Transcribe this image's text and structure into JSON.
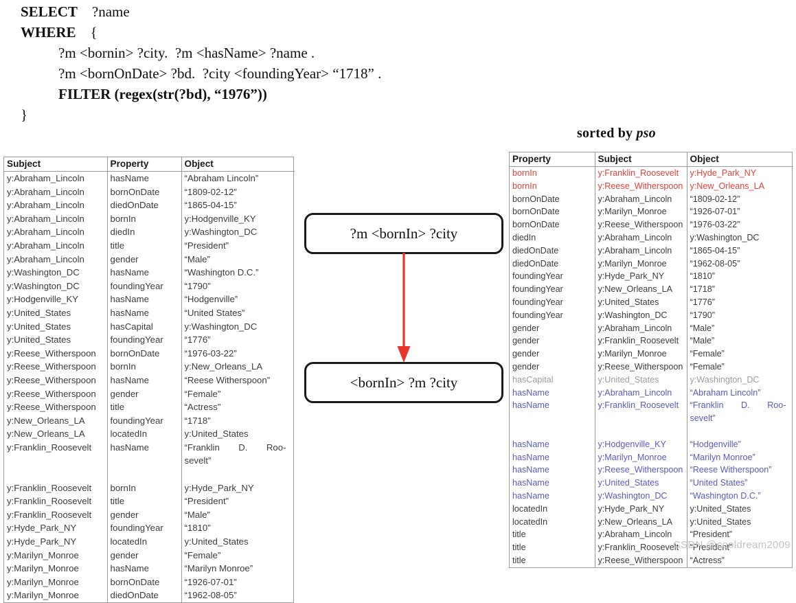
{
  "query": {
    "lines": [
      {
        "id": "l1",
        "indent": 0,
        "segments": [
          {
            "t": "SELECT",
            "bold": true
          },
          {
            "t": "    ?name",
            "bold": false
          }
        ]
      },
      {
        "id": "l2",
        "indent": 0,
        "segments": [
          {
            "t": "WHERE",
            "bold": true
          },
          {
            "t": "    {",
            "bold": false
          }
        ]
      },
      {
        "id": "l3",
        "indent": 55,
        "segments": [
          {
            "t": "?m <bornin> ?city.  ?m <hasName> ?name .",
            "bold": false
          }
        ]
      },
      {
        "id": "l4",
        "indent": 55,
        "segments": [
          {
            "t": "?m <bornOnDate> ?bd.  ?city <foundingYear> “1718” .",
            "bold": false
          }
        ]
      },
      {
        "id": "l5",
        "indent": 55,
        "segments": [
          {
            "t": "FILTER (regex(str(?bd), “1976”))",
            "bold": true
          }
        ]
      },
      {
        "id": "l6",
        "indent": 0,
        "segments": [
          {
            "t": "}",
            "bold": false
          }
        ]
      }
    ],
    "text_lines": [
      "SELECT    ?name",
      "WHERE    {",
      "?m <bornin> ?city.  ?m <hasName> ?name .",
      "?m <bornOnDate> ?bd.  ?city <foundingYear> “1718” .",
      "FILTER (regex(str(?bd), “1976”))",
      "}"
    ]
  },
  "sorted_caption": {
    "prefix": "sorted by ",
    "index_name": "pso"
  },
  "spo_table": {
    "title": "Subject Property Object triple table",
    "headers": [
      "Subject",
      "Property",
      "Object"
    ],
    "rows": [
      {
        "cells": [
          "y:Abraham_Lincoln",
          "hasName",
          "“Abraham Lincoln”"
        ],
        "style": "normal"
      },
      {
        "cells": [
          "y:Abraham_Lincoln",
          "bornOnDate",
          "“1809-02-12”"
        ],
        "style": "normal"
      },
      {
        "cells": [
          "y:Abraham_Lincoln",
          "diedOnDate",
          "“1865-04-15”"
        ],
        "style": "normal"
      },
      {
        "cells": [
          "y:Abraham_Lincoln",
          "bornIn",
          "y:Hodgenville_KY"
        ],
        "style": "normal"
      },
      {
        "cells": [
          "y:Abraham_Lincoln",
          "diedIn",
          "y:Washington_DC"
        ],
        "style": "normal"
      },
      {
        "cells": [
          "y:Abraham_Lincoln",
          "title",
          "“President”"
        ],
        "style": "normal"
      },
      {
        "cells": [
          "y:Abraham_Lincoln",
          "gender",
          "“Male”"
        ],
        "style": "normal"
      },
      {
        "cells": [
          "y:Washington_DC",
          "hasName",
          "“Washington D.C.”"
        ],
        "style": "normal"
      },
      {
        "cells": [
          "y:Washington_DC",
          "foundingYear",
          "“1790”"
        ],
        "style": "normal"
      },
      {
        "cells": [
          "y:Hodgenville_KY",
          "hasName",
          "“Hodgenville”"
        ],
        "style": "normal"
      },
      {
        "cells": [
          "y:United_States",
          "hasName",
          "“United States”"
        ],
        "style": "normal"
      },
      {
        "cells": [
          "y:United_States",
          "hasCapital",
          "y:Washington_DC"
        ],
        "style": "normal"
      },
      {
        "cells": [
          "y:United_States",
          "foundingYear",
          "“1776”"
        ],
        "style": "normal"
      },
      {
        "cells": [
          "y:Reese_Witherspoon",
          "bornOnDate",
          "“1976-03-22”"
        ],
        "style": "normal"
      },
      {
        "cells": [
          "y:Reese_Witherspoon",
          "bornIn",
          "y:New_Orleans_LA"
        ],
        "style": "normal"
      },
      {
        "cells": [
          "y:Reese_Witherspoon",
          "hasName",
          "“Reese Witherspoon”"
        ],
        "style": "normal"
      },
      {
        "cells": [
          "y:Reese_Witherspoon",
          "gender",
          "“Female”"
        ],
        "style": "normal"
      },
      {
        "cells": [
          "y:Reese_Witherspoon",
          "title",
          "“Actress”"
        ],
        "style": "normal"
      },
      {
        "cells": [
          "y:New_Orleans_LA",
          "foundingYear",
          "“1718”"
        ],
        "style": "normal"
      },
      {
        "cells": [
          "y:New_Orleans_LA",
          "locatedIn",
          "y:United_States"
        ],
        "style": "normal"
      },
      {
        "cells": [
          "y:Franklin_Roosevelt",
          "hasName",
          "“Franklin D. Roo-sevelt”"
        ],
        "style": "wrapped",
        "wrap": [
          "“Franklin     D.     Roo-",
          "sevelt”"
        ]
      },
      {
        "cells": [
          "",
          "",
          ""
        ],
        "style": "spacer"
      },
      {
        "cells": [
          "y:Franklin_Roosevelt",
          "bornIn",
          "y:Hyde_Park_NY"
        ],
        "style": "normal"
      },
      {
        "cells": [
          "y:Franklin_Roosevelt",
          "title",
          "“President”"
        ],
        "style": "normal"
      },
      {
        "cells": [
          "y:Franklin_Roosevelt",
          "gender",
          "“Male”"
        ],
        "style": "normal"
      },
      {
        "cells": [
          "y:Hyde_Park_NY",
          "foundingYear",
          "“1810”"
        ],
        "style": "normal"
      },
      {
        "cells": [
          "y:Hyde_Park_NY",
          "locatedIn",
          "y:United_States"
        ],
        "style": "normal"
      },
      {
        "cells": [
          "y:Marilyn_Monroe",
          "gender",
          "“Female”"
        ],
        "style": "normal"
      },
      {
        "cells": [
          "y:Marilyn_Monroe",
          "hasName",
          "“Marilyn Monroe”"
        ],
        "style": "normal"
      },
      {
        "cells": [
          "y:Marilyn_Monroe",
          "bornOnDate",
          "“1926-07-01”"
        ],
        "style": "normal"
      },
      {
        "cells": [
          "y:Marilyn_Monroe",
          "diedOnDate",
          "“1962-08-05”"
        ],
        "style": "normal"
      }
    ]
  },
  "pso_table": {
    "title": "Property Subject Object index sorted by pso",
    "headers": [
      "Property",
      "Subject",
      "Object"
    ],
    "rows": [
      {
        "cells": [
          "bornIn",
          "y:Franklin_Roosevelt",
          "y:Hyde_Park_NY"
        ],
        "style": "normal",
        "highlight": "red"
      },
      {
        "cells": [
          "bornIn",
          "y:Reese_Witherspoon",
          "y:New_Orleans_LA"
        ],
        "style": "normal",
        "highlight": "red"
      },
      {
        "cells": [
          "bornOnDate",
          "y:Abraham_Lincoln",
          "“1809-02-12”"
        ],
        "style": "normal",
        "highlight": "none"
      },
      {
        "cells": [
          "bornOnDate",
          "y:Marilyn_Monroe",
          "“1926-07-01”"
        ],
        "style": "normal",
        "highlight": "none"
      },
      {
        "cells": [
          "bornOnDate",
          "y:Reese_Witherspoon",
          "“1976-03-22”"
        ],
        "style": "normal",
        "highlight": "none"
      },
      {
        "cells": [
          "diedIn",
          "y:Abraham_Lincoln",
          "y:Washington_DC"
        ],
        "style": "normal",
        "highlight": "none"
      },
      {
        "cells": [
          "diedOnDate",
          "y:Abraham_Lincoln",
          "“1865-04-15”"
        ],
        "style": "normal",
        "highlight": "none"
      },
      {
        "cells": [
          "diedOnDate",
          "y:Marilyn_Monroe",
          "“1962-08-05”"
        ],
        "style": "normal",
        "highlight": "none"
      },
      {
        "cells": [
          "foundingYear",
          "y:Hyde_Park_NY",
          "“1810”"
        ],
        "style": "normal",
        "highlight": "none"
      },
      {
        "cells": [
          "foundingYear",
          "y:New_Orleans_LA",
          "“1718”"
        ],
        "style": "normal",
        "highlight": "none"
      },
      {
        "cells": [
          "foundingYear",
          "y:United_States",
          "“1776”"
        ],
        "style": "normal",
        "highlight": "none"
      },
      {
        "cells": [
          "foundingYear",
          "y:Washington_DC",
          "“1790”"
        ],
        "style": "normal",
        "highlight": "none"
      },
      {
        "cells": [
          "gender",
          "y:Abraham_Lincoln",
          "“Male”"
        ],
        "style": "normal",
        "highlight": "none"
      },
      {
        "cells": [
          "gender",
          "y:Franklin_Roosevelt",
          "“Male”"
        ],
        "style": "normal",
        "highlight": "none"
      },
      {
        "cells": [
          "gender",
          "y:Marilyn_Monroe",
          "“Female”"
        ],
        "style": "normal",
        "highlight": "none"
      },
      {
        "cells": [
          "gender",
          "y:Reese_Witherspoon",
          "“Female”"
        ],
        "style": "normal",
        "highlight": "none"
      },
      {
        "cells": [
          "hasCapital",
          "y:United_States",
          "y:Washington_DC"
        ],
        "style": "normal",
        "highlight": "faded"
      },
      {
        "cells": [
          "hasName",
          "y:Abraham_Lincoln",
          "“Abraham Lincoln”"
        ],
        "style": "normal",
        "highlight": "blue"
      },
      {
        "cells": [
          "hasName",
          "y:Franklin_Roosevelt",
          "“Franklin D. Roo-sevelt”"
        ],
        "style": "wrapped",
        "highlight": "blue",
        "wrap": [
          "“Franklin     D.     Roo-",
          "sevelt”"
        ]
      },
      {
        "cells": [
          "",
          "",
          ""
        ],
        "style": "spacer",
        "highlight": "none"
      },
      {
        "cells": [
          "hasName",
          "y:Hodgenville_KY",
          "“Hodgenville”"
        ],
        "style": "normal",
        "highlight": "blue"
      },
      {
        "cells": [
          "hasName",
          "y:Marilyn_Monroe",
          "“Marilyn Monroe”"
        ],
        "style": "normal",
        "highlight": "blue"
      },
      {
        "cells": [
          "hasName",
          "y:Reese_Witherspoon",
          "“Reese Witherspoon”"
        ],
        "style": "normal",
        "highlight": "blue"
      },
      {
        "cells": [
          "hasName",
          "y:United_States",
          "“United States”"
        ],
        "style": "normal",
        "highlight": "blue"
      },
      {
        "cells": [
          "hasName",
          "y:Washington_DC",
          "“Washington D.C.”"
        ],
        "style": "normal",
        "highlight": "blue"
      },
      {
        "cells": [
          "locatedIn",
          "y:Hyde_Park_NY",
          "y:United_States"
        ],
        "style": "normal",
        "highlight": "none"
      },
      {
        "cells": [
          "locatedIn",
          "y:New_Orleans_LA",
          "y:United_States"
        ],
        "style": "normal",
        "highlight": "none"
      },
      {
        "cells": [
          "title",
          "y:Abraham_Lincoln",
          "“President”"
        ],
        "style": "normal",
        "highlight": "none"
      },
      {
        "cells": [
          "title",
          "y:Franklin_Roosevelt",
          "“President”"
        ],
        "style": "normal",
        "highlight": "none"
      },
      {
        "cells": [
          "title",
          "y:Reese_Witherspoon",
          "“Actress”"
        ],
        "style": "normal",
        "highlight": "none"
      }
    ]
  },
  "patterns": {
    "top_box_label": "?m <bornIn> ?city",
    "bottom_box_label": "<bornIn> ?m ?city",
    "arrow_name": "reorder-arrow-down"
  },
  "colors": {
    "highlight_red": "#e1403a",
    "highlight_blue": "#5a5ac4",
    "highlight_faded": "#9d9d9d",
    "arrow": "#e8352c",
    "table_border": "#9a9a9a",
    "box_border": "#1a1a1a",
    "watermark": "#c3c3c3"
  },
  "watermark": {
    "text": "CSDN @cooldream2009"
  }
}
